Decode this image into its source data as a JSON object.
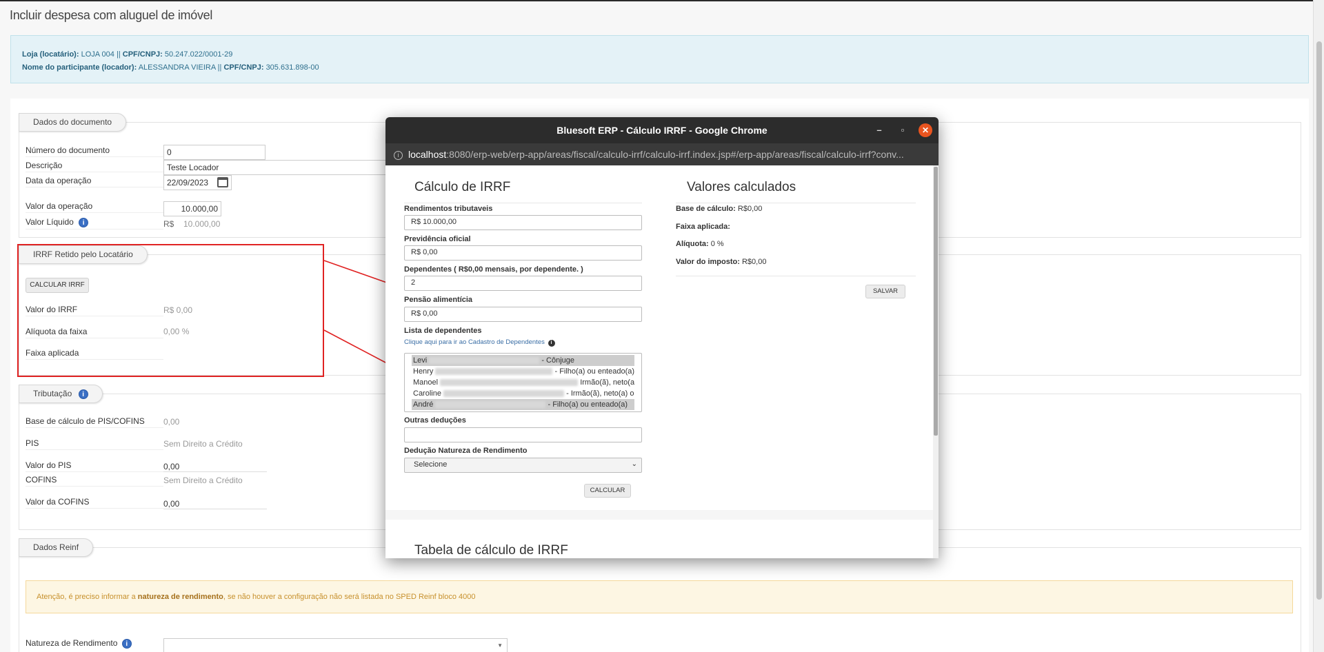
{
  "page": {
    "title": "Incluir despesa com aluguel de imóvel",
    "info": {
      "loja_label": "Loja (locatário):",
      "loja_value": "LOJA 004",
      "cpf1_label": "CPF/CNPJ:",
      "cpf1_value": "50.247.022/0001-29",
      "participante_label": "Nome do participante (locador):",
      "participante_value": "ALESSANDRA VIEIRA",
      "cpf2_label": "CPF/CNPJ:",
      "cpf2_value": "305.631.898-00",
      "sep": "||"
    }
  },
  "documento": {
    "legend": "Dados do documento",
    "numero_label": "Número do documento",
    "numero_value": "0",
    "descricao_label": "Descrição",
    "descricao_value": "Teste Locador",
    "data_label": "Data da operação",
    "data_value": "22/09/2023",
    "valor_op_label": "Valor da operação",
    "valor_op_value": "10.000,00",
    "valor_liq_label": "Valor Líquido",
    "valor_liq_currency": "R$",
    "valor_liq_value": "10.000,00"
  },
  "irrf": {
    "legend": "IRRF Retido pelo Locatário",
    "calc_button": "CALCULAR IRRF",
    "valor_label": "Valor do IRRF",
    "valor_value": "R$ 0,00",
    "aliquota_label": "Alíquota da faixa",
    "aliquota_value": "0,00 %",
    "faixa_label": "Faixa aplicada"
  },
  "tributacao": {
    "legend": "Tributação",
    "base_label": "Base de cálculo de PIS/COFINS",
    "base_value": "0,00",
    "pis_label": "PIS",
    "pis_value": "Sem Direito a Crédito",
    "valor_pis_label": "Valor do PIS",
    "valor_pis_value": "0,00",
    "cofins_label": "COFINS",
    "cofins_value": "Sem Direito a Crédito",
    "valor_cofins_label": "Valor da COFINS",
    "valor_cofins_value": "0,00"
  },
  "reinf": {
    "legend": "Dados Reinf",
    "warning_pre": "Atenção, é preciso informar a ",
    "warning_bold": "natureza de rendimento",
    "warning_post": ", se não houver a configuração não será listada no SPED Reinf bloco 4000",
    "natureza_label": "Natureza de Rendimento"
  },
  "popup": {
    "window_title": "Bluesoft ERP - Cálculo IRRF - Google Chrome",
    "url_host": "localhost",
    "url_rest": ":8080/erp-web/erp-app/areas/fiscal/calculo-irrf/calculo-irrf.index.jsp#/erp-app/areas/fiscal/calculo-irrf?conv...",
    "calc_title": "Cálculo de IRRF",
    "rend_label": "Rendimentos tributaveis",
    "rend_value": "R$ 10.000,00",
    "prev_label": "Previdência oficial",
    "prev_value": "R$ 0,00",
    "dep_label": "Dependentes ( R$0,00 mensais, por dependente. )",
    "dep_value": "2",
    "pensao_label": "Pensão alimentícia",
    "pensao_value": "R$ 0,00",
    "lista_label": "Lista de dependentes",
    "cadastro_link": "Clique aqui para ir ao Cadastro de Dependentes",
    "dependentes": [
      {
        "nome": "Levi",
        "rel": "- Cônjuge"
      },
      {
        "nome": "Henry",
        "rel": "- Filho(a) ou enteado(a)"
      },
      {
        "nome": "Manoel",
        "rel": "Irmão(ã), neto(a)"
      },
      {
        "nome": "Caroline",
        "rel": "- Irmão(ã), neto(a) o"
      },
      {
        "nome": "André",
        "rel": "- Filho(a) ou enteado(a)"
      }
    ],
    "outras_label": "Outras deduções",
    "outras_value": "",
    "deducao_label": "Dedução Natureza de Rendimento",
    "deducao_value": "Selecione",
    "calcular_button": "CALCULAR",
    "valores_title": "Valores calculados",
    "base_label": "Base de cálculo:",
    "base_value": "R$0,00",
    "faixa_label": "Faixa aplicada:",
    "faixa_value": "",
    "aliquota_label": "Alíquota:",
    "aliquota_value": "0 %",
    "imposto_label": "Valor do imposto:",
    "imposto_value": "R$0,00",
    "salvar_button": "SALVAR",
    "tabela_title": "Tabela de cálculo de IRRF"
  }
}
